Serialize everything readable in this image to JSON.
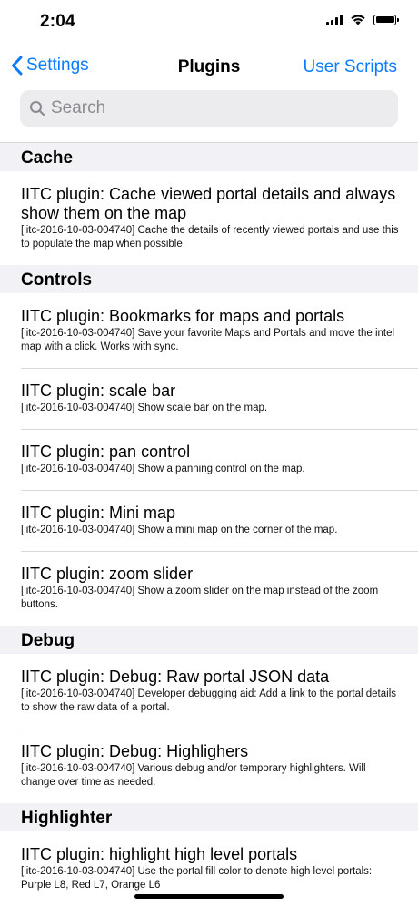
{
  "status": {
    "time": "2:04"
  },
  "nav": {
    "back_label": "Settings",
    "title": "Plugins",
    "right_label": "User Scripts"
  },
  "search": {
    "placeholder": "Search",
    "value": ""
  },
  "sections": [
    {
      "name": "Cache",
      "items": [
        {
          "title": "IITC plugin: Cache viewed portal details and always show them on the map",
          "desc": "[iitc-2016-10-03-004740] Cache the details of recently viewed portals and use this to populate the map when possible"
        }
      ]
    },
    {
      "name": "Controls",
      "items": [
        {
          "title": "IITC plugin: Bookmarks for maps and portals",
          "desc": "[iitc-2016-10-03-004740] Save your favorite Maps and Portals and move the intel map with a click. Works with sync."
        },
        {
          "title": "IITC plugin: scale bar",
          "desc": "[iitc-2016-10-03-004740] Show scale bar on the map."
        },
        {
          "title": "IITC plugin: pan control",
          "desc": "[iitc-2016-10-03-004740] Show a panning control on the map."
        },
        {
          "title": "IITC plugin: Mini map",
          "desc": "[iitc-2016-10-03-004740] Show a mini map on the corner of the map."
        },
        {
          "title": "IITC plugin: zoom slider",
          "desc": "[iitc-2016-10-03-004740] Show a zoom slider on the map instead of the zoom buttons."
        }
      ]
    },
    {
      "name": "Debug",
      "items": [
        {
          "title": "IITC plugin: Debug: Raw portal JSON data",
          "desc": "[iitc-2016-10-03-004740] Developer debugging aid: Add a link to the portal details to show the raw data of a portal."
        },
        {
          "title": "IITC plugin: Debug: Highlighers",
          "desc": "[iitc-2016-10-03-004740] Various debug and/or temporary highlighters. Will change over time as needed."
        }
      ]
    },
    {
      "name": "Highlighter",
      "items": [
        {
          "title": "IITC plugin: highlight high level portals",
          "desc": "[iitc-2016-10-03-004740] Use the portal fill color to denote high level portals: Purple L8, Red L7, Orange L6"
        }
      ]
    }
  ],
  "colors": {
    "accent": "#0a7cff",
    "section_bg": "#f2f2f6",
    "separator": "#d8d8dc"
  },
  "icons": [
    "chevron-left-icon",
    "search-icon",
    "signal-icon",
    "wifi-icon",
    "battery-icon"
  ]
}
